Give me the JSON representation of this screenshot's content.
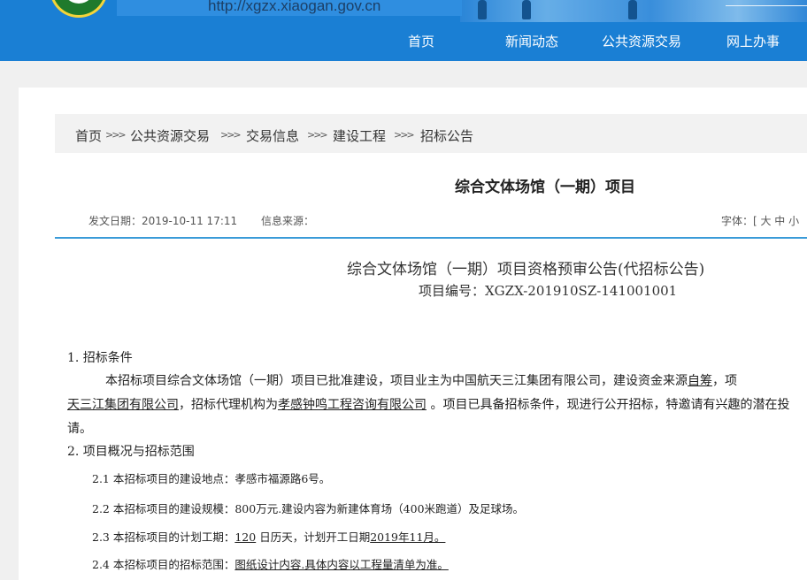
{
  "header": {
    "url": "http://xgzx.xiaogan.gov.cn",
    "nav": [
      "首页",
      "新闻动态",
      "公共资源交易",
      "网上办事"
    ]
  },
  "breadcrumb": {
    "items": [
      "首页",
      "公共资源交易",
      "交易信息",
      "建设工程",
      "招标公告"
    ],
    "separator": ">>>"
  },
  "article": {
    "title": "综合文体场馆（一期）项目",
    "date_label": "发文日期：2019-10-11 17:11",
    "source_label": "信息来源：",
    "font_size_label": "字体：[ 大 中 小",
    "doc_title": "综合文体场馆（一期）项目资格预审公告(代招标公告)",
    "doc_number": "项目编号：XGZX-201910SZ-141001001",
    "section1_heading": "1. 招标条件",
    "para1_line1_a": "本招标项目综合文体场馆（一期）项目已批准建设，项目业主为中国航天三江集团有限公司，建设资金来源",
    "para1_line1_b": "自筹",
    "para1_line1_c": "，项",
    "para1_line2_a": "天三江集团有限公司",
    "para1_line2_b": "，招标代理机构为",
    "para1_line2_c": "孝感钟鸣工程咨询有限公司",
    "para1_line2_d": " 。项目已具备招标条件，现进行公开招标，特邀请有兴趣的潜在投",
    "para1_line3": "请。",
    "section2_heading": "2. 项目概况与招标范围",
    "item21": "2.1 本招标项目的建设地点：孝感市福源路6号。",
    "item22": "2.2 本招标项目的建设规模：800万元.建设内容为新建体育场（400米跑道）及足球场。",
    "item23_a": "2.3 本招标项目的计划工期：",
    "item23_b": "120",
    "item23_c": " 日历天，计划开工日期",
    "item23_d": "2019年11月。",
    "item24_a": "2.4 本招标项目的招标范围：",
    "item24_b": "图纸设计内容.具体内容以工程量清单为准。"
  },
  "colors": {
    "header_blue": "#1a7fd4",
    "divider_blue": "#3a9bd8"
  }
}
